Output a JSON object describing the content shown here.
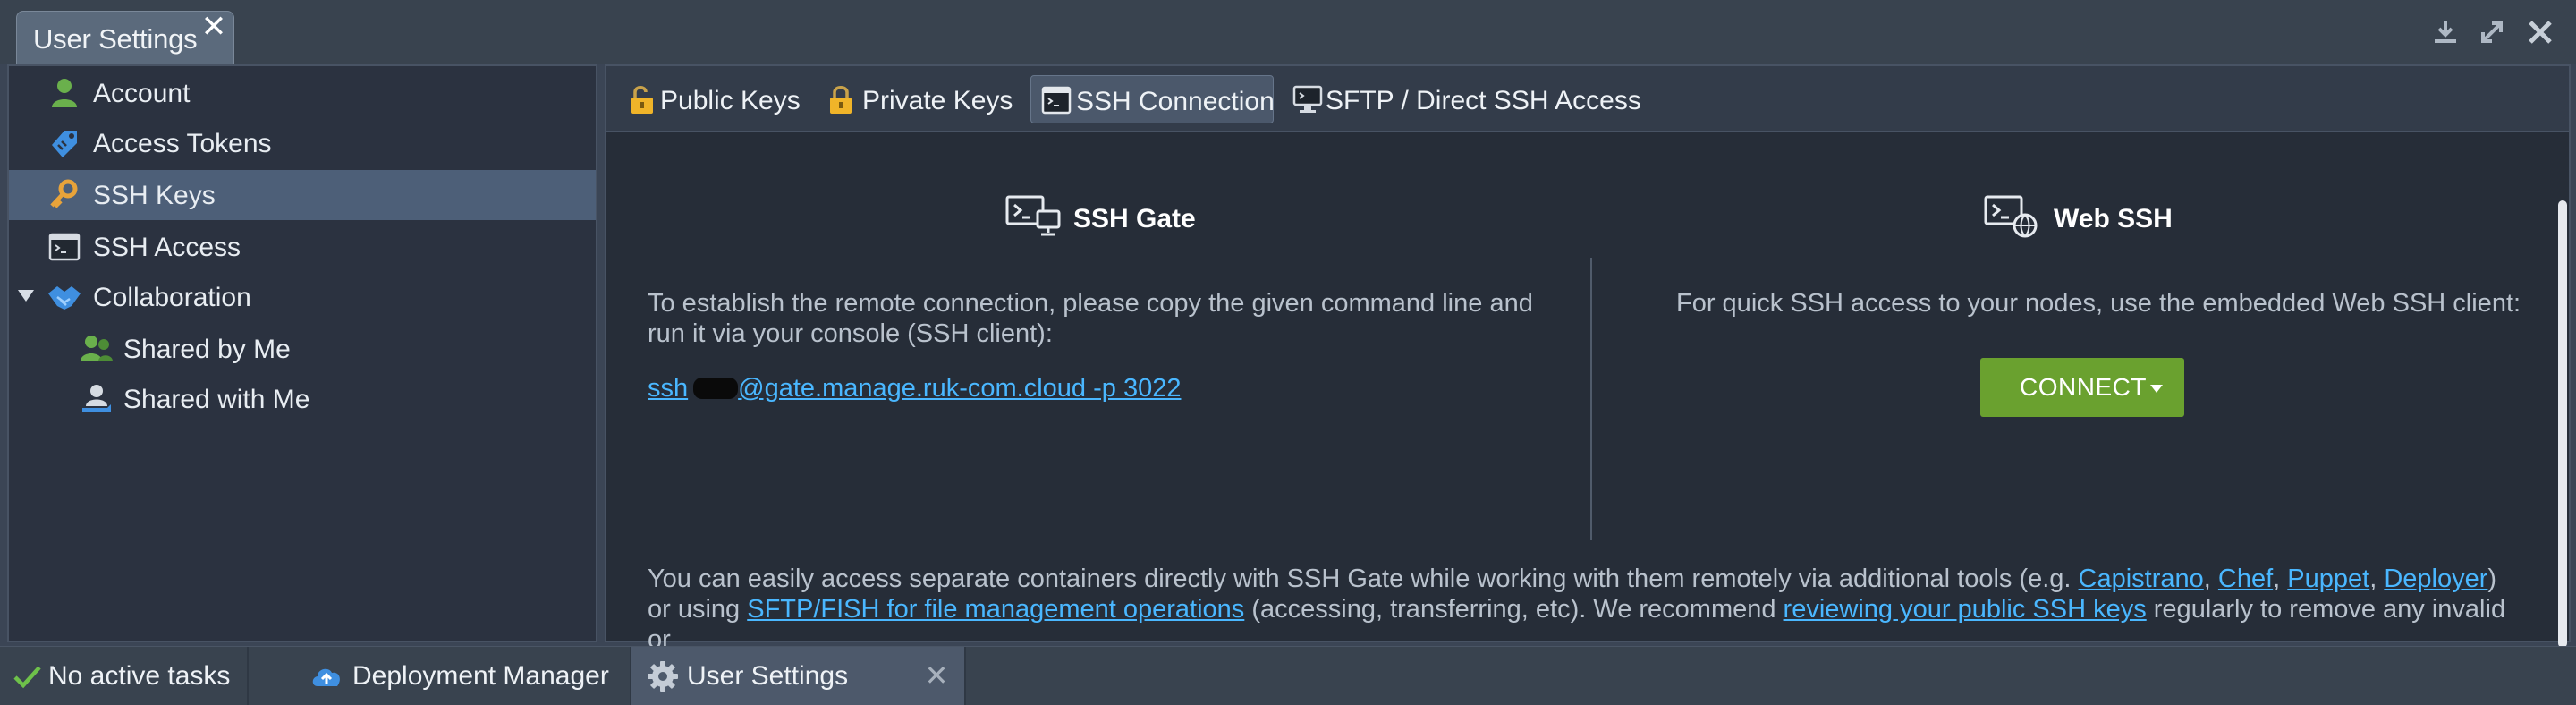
{
  "window": {
    "title": "User Settings",
    "close_glyph": "✕",
    "controls": [
      "download-icon",
      "expand-icon",
      "close-icon"
    ]
  },
  "sidebar": {
    "items": [
      {
        "label": "Account",
        "icon": "user-icon"
      },
      {
        "label": "Access Tokens",
        "icon": "tag-icon"
      },
      {
        "label": "SSH Keys",
        "icon": "key-icon",
        "selected": true
      },
      {
        "label": "SSH Access",
        "icon": "terminal-icon"
      },
      {
        "label": "Collaboration",
        "icon": "handshake-icon",
        "expanded": true
      },
      {
        "label": "Shared by Me",
        "icon": "users-icon"
      },
      {
        "label": "Shared with Me",
        "icon": "user-share-icon"
      }
    ]
  },
  "tabs": [
    {
      "label": "Public Keys",
      "icon": "unlocked-icon"
    },
    {
      "label": "Private Keys",
      "icon": "lock-icon"
    },
    {
      "label": "SSH Connection",
      "icon": "terminal-icon",
      "active": true
    },
    {
      "label": "SFTP / Direct SSH Access",
      "icon": "monitor-icon"
    }
  ],
  "ssh_gate": {
    "title": "SSH Gate",
    "description": "To establish the remote connection, please copy the given command line and run it via your console (SSH client):",
    "command_prefix": "ssh",
    "command_suffix": "@gate.manage.ruk-com.cloud -p 3022"
  },
  "web_ssh": {
    "title": "Web SSH",
    "description": "For quick SSH access to your nodes, use the embedded Web SSH client:",
    "button_label": "CONNECT"
  },
  "footer_text": {
    "part1": "You can easily access separate containers directly with SSH Gate while working with them remotely via additional tools (e.g. ",
    "link_capistrano": "Capistrano",
    "sep1": ", ",
    "link_chef": "Chef",
    "sep2": ", ",
    "link_puppet": "Puppet",
    "sep3": ", ",
    "link_deployer": "Deployer",
    "part2": ") or using ",
    "link_sftp": "SFTP/FISH for file management operations",
    "part3": " (accessing, transferring, etc). We recommend ",
    "link_review": "reviewing your public SSH keys",
    "part4": " regularly to remove any invalid or"
  },
  "taskbar": {
    "items": [
      {
        "label": "No active tasks",
        "icon": "check-icon"
      },
      {
        "label": "Deployment Manager",
        "icon": "cloud-upload-icon"
      },
      {
        "label": "User Settings",
        "icon": "gear-icon",
        "active": true
      }
    ],
    "close_glyph": "✕"
  },
  "colors": {
    "accent_link": "#4ab7ff",
    "connect_button": "#6aa12f",
    "selected_row": "#4d5f78",
    "check": "#6ec14a"
  }
}
